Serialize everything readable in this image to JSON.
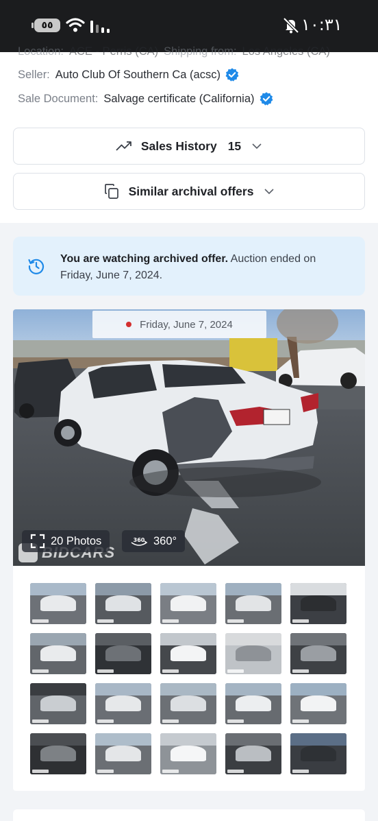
{
  "status_bar": {
    "battery": "٥٥",
    "time": "١٠:٣١",
    "icons": [
      "battery-icon",
      "wifi-icon",
      "signal-icon",
      "mute-icon"
    ]
  },
  "lot_info": {
    "location_label": "Location:",
    "location_value": "ACE - Perris (CA)",
    "shipping_label": "Shipping from:",
    "shipping_value": "Los Angeles (CA)",
    "seller_label": "Seller:",
    "seller_value": "Auto Club Of Southern Ca (acsc)",
    "doc_label": "Sale Document:",
    "doc_value": "Salvage certificate (California)"
  },
  "sales_history": {
    "label": "Sales History",
    "count": "15"
  },
  "similar_offers": {
    "label": "Similar archival offers"
  },
  "notice": {
    "bold": "You are watching archived offer.",
    "text": " Auction ended on Friday, June 7, 2024."
  },
  "gallery": {
    "date": "Friday, June 7, 2024",
    "photos_label": "20 Photos",
    "view360_label": "360°",
    "view360_icon_text": "360",
    "watermark": "BIDCARS",
    "thumbnail_count": 20
  },
  "colors": {
    "accent_blue": "#1f8ae8",
    "notice_bg": "#e3f1fc",
    "live_dot": "#d32f2f"
  }
}
